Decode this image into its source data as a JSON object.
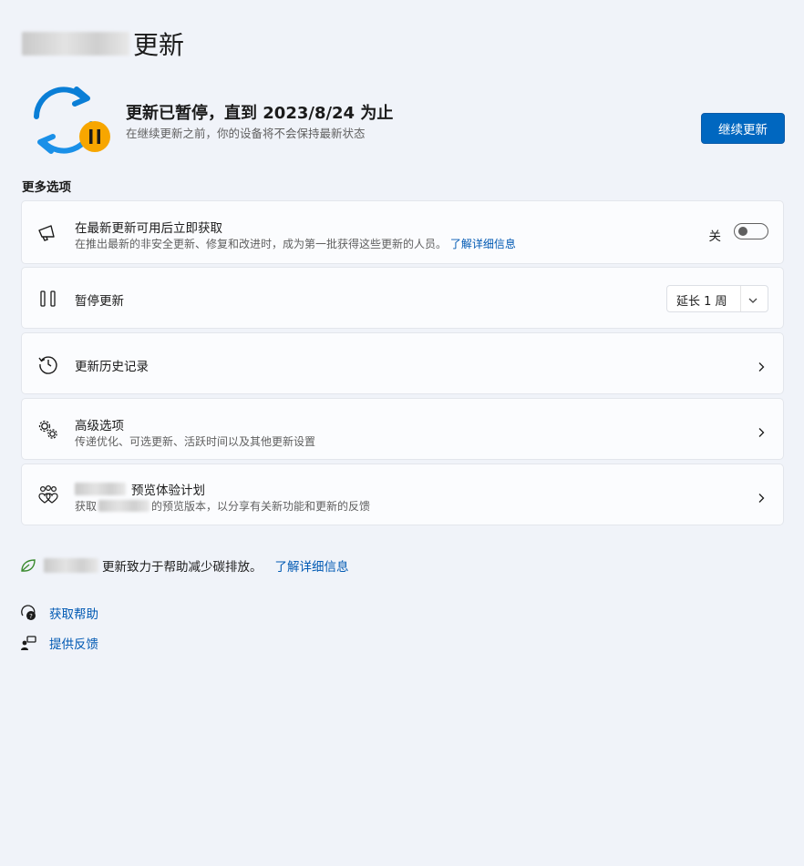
{
  "header": {
    "title_suffix": "更新"
  },
  "status": {
    "headline": "更新已暂停，直到 2023/8/24 为止",
    "subtext": "在继续更新之前，你的设备将不会保持最新状态",
    "resume_label": "继续更新"
  },
  "more_options": {
    "label": "更多选项",
    "items": [
      {
        "title": "在最新更新可用后立即获取",
        "desc": "在推出最新的非安全更新、修复和改进时，成为第一批获得这些更新的人员。",
        "link": "了解详细信息",
        "toggle_label": "关",
        "toggle_on": false
      },
      {
        "title": "暂停更新",
        "dropdown_value": "延长 1 周"
      },
      {
        "title": "更新历史记录"
      },
      {
        "title": "高级选项",
        "desc": "传递优化、可选更新、活跃时间以及其他更新设置"
      },
      {
        "title": "预览体验计划",
        "desc_prefix": "获取 ",
        "desc_suffix": "的预览版本，以分享有关新功能和更新的反馈"
      }
    ]
  },
  "carbon": {
    "text": "更新致力于帮助减少碳排放。",
    "link": "了解详细信息"
  },
  "help": {
    "get_help": "获取帮助",
    "feedback": "提供反馈"
  },
  "colors": {
    "accent": "#0067c0",
    "link": "#0059b3",
    "pause_badge": "#f7a600",
    "sync_blue": "#0a7ed6"
  },
  "icons": [
    "sync-paused-icon",
    "megaphone-icon",
    "pause-icon",
    "history-icon",
    "gears-icon",
    "insider-hearts-icon",
    "leaf-icon",
    "help-icon",
    "feedback-icon",
    "chevron-right-icon",
    "chevron-down-icon"
  ]
}
